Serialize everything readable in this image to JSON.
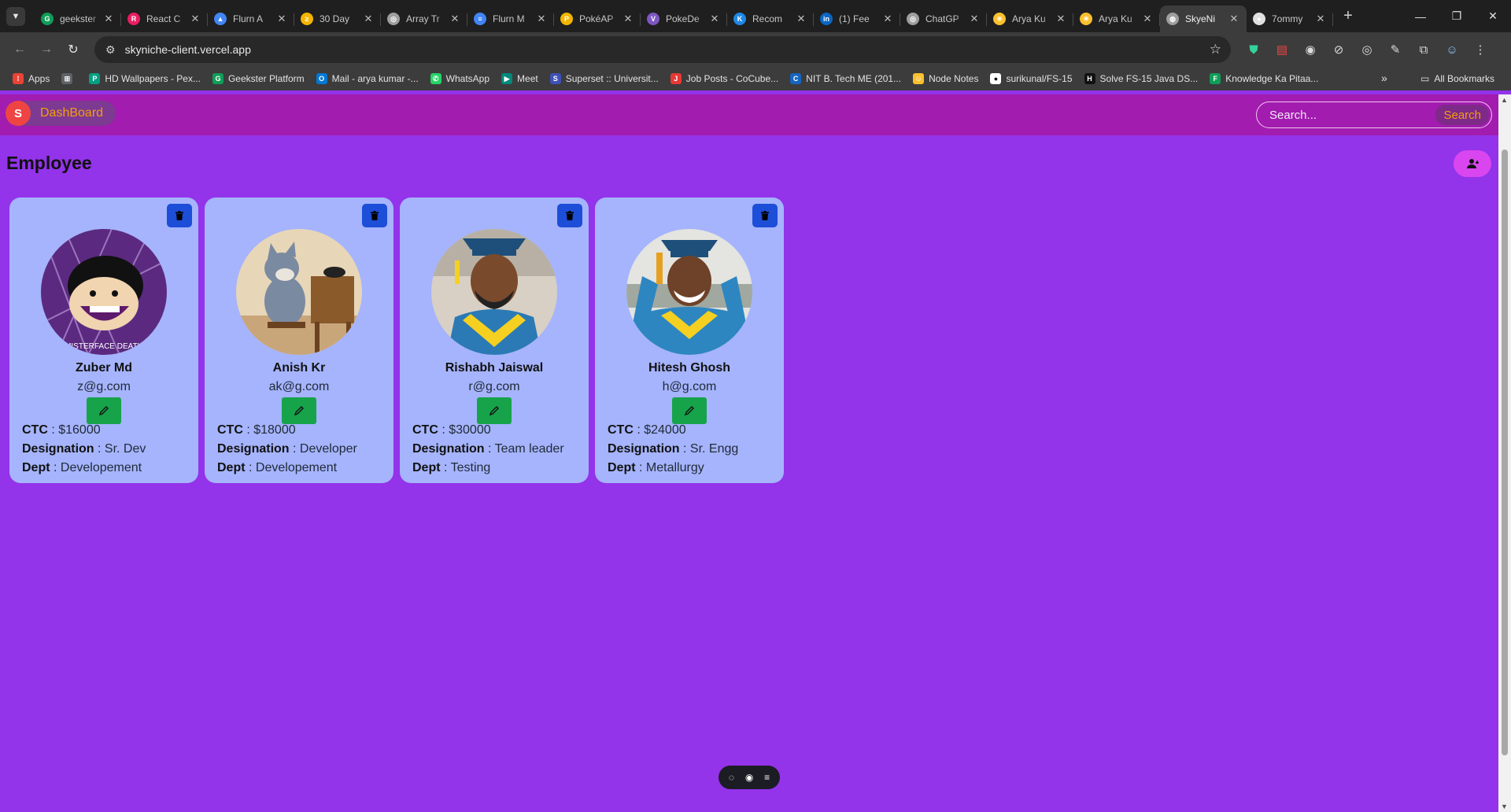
{
  "browser": {
    "tabs": [
      {
        "title": "geekster",
        "color": "#0f9d58",
        "glyph": "G"
      },
      {
        "title": "React C",
        "color": "#e91e63",
        "glyph": "R"
      },
      {
        "title": "Flurn A",
        "color": "#4285f4",
        "glyph": "▲"
      },
      {
        "title": "30 Day",
        "color": "#f4b400",
        "glyph": "≥"
      },
      {
        "title": "Array Tr",
        "color": "#9e9e9e",
        "glyph": "◎"
      },
      {
        "title": "Flurn M",
        "color": "#4285f4",
        "glyph": "≡"
      },
      {
        "title": "PokéAP",
        "color": "#f4b400",
        "glyph": "P"
      },
      {
        "title": "PokeDe",
        "color": "#7e57c2",
        "glyph": "V"
      },
      {
        "title": "Recom",
        "color": "#1e88e5",
        "glyph": "K"
      },
      {
        "title": "(1) Fee",
        "color": "#0a66c2",
        "glyph": "in"
      },
      {
        "title": "ChatGP",
        "color": "#9e9e9e",
        "glyph": "◎"
      },
      {
        "title": "Arya Ku",
        "color": "#fbc02d",
        "glyph": "☀"
      },
      {
        "title": "Arya Ku",
        "color": "#fbc02d",
        "glyph": "☀"
      },
      {
        "title": "SkyeNi",
        "color": "#9e9e9e",
        "glyph": "◍",
        "active": true
      },
      {
        "title": "7ommy",
        "color": "#e0e0e0",
        "glyph": "●"
      }
    ],
    "url": "skyniche-client.vercel.app",
    "bookmarks": [
      {
        "label": "Apps",
        "color": "#ea4335",
        "glyph": "⁞"
      },
      {
        "label": "",
        "color": "#5f6368",
        "glyph": "⊞"
      },
      {
        "label": "HD Wallpapers - Pex...",
        "color": "#05a081",
        "glyph": "P"
      },
      {
        "label": "Geekster Platform",
        "color": "#0f9d58",
        "glyph": "G"
      },
      {
        "label": "Mail - arya kumar -...",
        "color": "#0078d4",
        "glyph": "O"
      },
      {
        "label": "WhatsApp",
        "color": "#25d366",
        "glyph": "✆"
      },
      {
        "label": "Meet",
        "color": "#00897b",
        "glyph": "▶"
      },
      {
        "label": "Superset :: Universit...",
        "color": "#3f51b5",
        "glyph": "S"
      },
      {
        "label": "Job Posts - CoCube...",
        "color": "#e53935",
        "glyph": "J"
      },
      {
        "label": "NIT B. Tech ME (201...",
        "color": "#1565c0",
        "glyph": "C"
      },
      {
        "label": "Node Notes",
        "color": "#fbc02d",
        "glyph": "☺"
      },
      {
        "label": "surikunal/FS-15",
        "color": "#ffffff",
        "glyph": "●"
      },
      {
        "label": "Solve FS-15 Java DS...",
        "color": "#111111",
        "glyph": "H"
      },
      {
        "label": "Knowledge Ka Pitaa...",
        "color": "#0f9d58",
        "glyph": "F"
      }
    ],
    "all_bookmarks": "All Bookmarks"
  },
  "app": {
    "brand_initial": "S",
    "brand_label": "DashBoard",
    "search_placeholder": "Search...",
    "search_button": "Search",
    "page_title": "Employee"
  },
  "employees": [
    {
      "name": "Zuber Md",
      "email": "z@g.com",
      "ctc_label": "CTC",
      "ctc": "$16000",
      "designation_label": "Designation",
      "designation": "Sr. Dev",
      "dept_label": "Dept",
      "dept": "Developement",
      "photo_caption": "MISTERFACE DEATH"
    },
    {
      "name": "Anish Kr",
      "email": "ak@g.com",
      "ctc_label": "CTC",
      "ctc": "$18000",
      "designation_label": "Designation",
      "designation": "Developer",
      "dept_label": "Dept",
      "dept": "Developement"
    },
    {
      "name": "Rishabh Jaiswal",
      "email": "r@g.com",
      "ctc_label": "CTC",
      "ctc": "$30000",
      "designation_label": "Designation",
      "designation": "Team leader",
      "dept_label": "Dept",
      "dept": "Testing"
    },
    {
      "name": "Hitesh Ghosh",
      "email": "h@g.com",
      "ctc_label": "CTC",
      "ctc": "$24000",
      "designation_label": "Designation",
      "designation": "Sr. Engg",
      "dept_label": "Dept",
      "dept": "Metallurgy"
    }
  ],
  "colors": {
    "page_bg": "#9333ea",
    "navbar_bg": "#a21caf",
    "card_bg": "#a5b4fc",
    "delete_button": "#1d4ed8",
    "edit_button": "#16a34a",
    "add_button": "#d946ef",
    "brand_accent": "#f59e0b"
  }
}
